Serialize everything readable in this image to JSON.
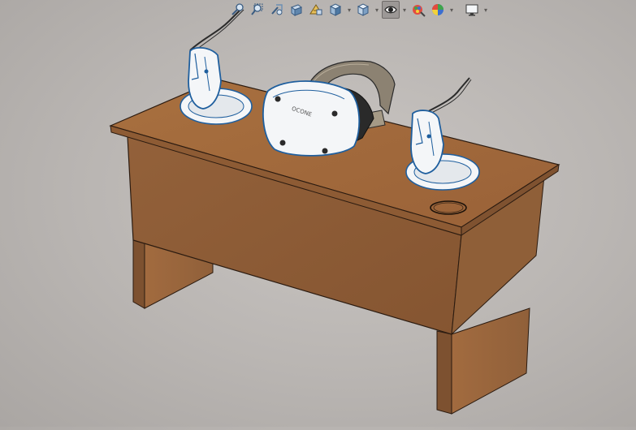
{
  "toolbar": {
    "items": [
      {
        "name": "zoom-to-fit-icon",
        "dropdown": false
      },
      {
        "name": "zoom-to-area-icon",
        "dropdown": false
      },
      {
        "name": "previous-view-icon",
        "dropdown": false
      },
      {
        "name": "section-view-icon",
        "dropdown": false
      },
      {
        "name": "dynamic-annotation-view-icon",
        "dropdown": false
      },
      {
        "name": "view-orientation-icon",
        "dropdown": true
      },
      {
        "name": "display-style-icon",
        "dropdown": true
      },
      {
        "name": "hide-show-items-icon",
        "dropdown": true,
        "active": true
      },
      {
        "name": "edit-appearance-icon",
        "dropdown": false
      },
      {
        "name": "apply-scene-icon",
        "dropdown": true
      },
      {
        "name": "view-settings-icon",
        "dropdown": true
      }
    ]
  },
  "model": {
    "headset_brand": "OCONE",
    "colors": {
      "wood_top": "#a26b3f",
      "wood_front": "#8a5a36",
      "wood_side": "#9a643a",
      "device_body": "#f4f6f8",
      "device_edge": "#1f5f9e",
      "strap": "#8c8272"
    }
  }
}
